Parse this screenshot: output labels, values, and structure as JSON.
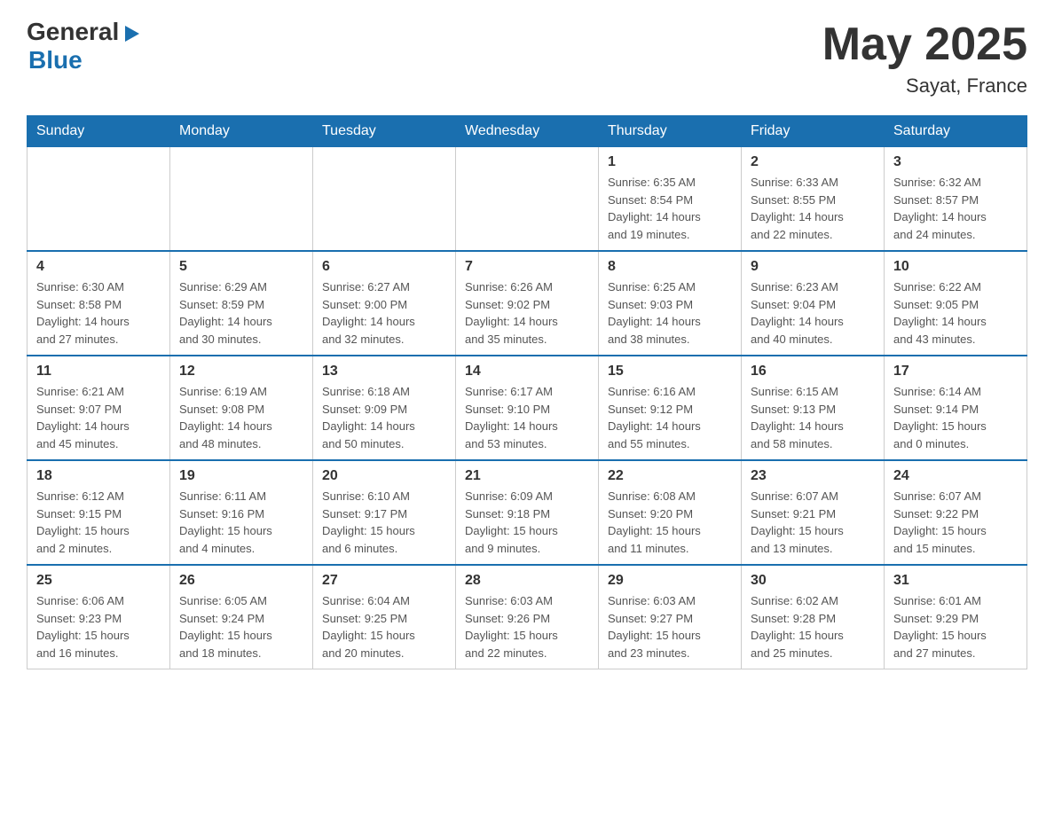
{
  "header": {
    "logo_general": "General",
    "logo_arrow": "▶",
    "logo_blue": "Blue",
    "month_year": "May 2025",
    "location": "Sayat, France"
  },
  "days_of_week": [
    "Sunday",
    "Monday",
    "Tuesday",
    "Wednesday",
    "Thursday",
    "Friday",
    "Saturday"
  ],
  "weeks": [
    [
      {
        "day": "",
        "info": ""
      },
      {
        "day": "",
        "info": ""
      },
      {
        "day": "",
        "info": ""
      },
      {
        "day": "",
        "info": ""
      },
      {
        "day": "1",
        "info": "Sunrise: 6:35 AM\nSunset: 8:54 PM\nDaylight: 14 hours\nand 19 minutes."
      },
      {
        "day": "2",
        "info": "Sunrise: 6:33 AM\nSunset: 8:55 PM\nDaylight: 14 hours\nand 22 minutes."
      },
      {
        "day": "3",
        "info": "Sunrise: 6:32 AM\nSunset: 8:57 PM\nDaylight: 14 hours\nand 24 minutes."
      }
    ],
    [
      {
        "day": "4",
        "info": "Sunrise: 6:30 AM\nSunset: 8:58 PM\nDaylight: 14 hours\nand 27 minutes."
      },
      {
        "day": "5",
        "info": "Sunrise: 6:29 AM\nSunset: 8:59 PM\nDaylight: 14 hours\nand 30 minutes."
      },
      {
        "day": "6",
        "info": "Sunrise: 6:27 AM\nSunset: 9:00 PM\nDaylight: 14 hours\nand 32 minutes."
      },
      {
        "day": "7",
        "info": "Sunrise: 6:26 AM\nSunset: 9:02 PM\nDaylight: 14 hours\nand 35 minutes."
      },
      {
        "day": "8",
        "info": "Sunrise: 6:25 AM\nSunset: 9:03 PM\nDaylight: 14 hours\nand 38 minutes."
      },
      {
        "day": "9",
        "info": "Sunrise: 6:23 AM\nSunset: 9:04 PM\nDaylight: 14 hours\nand 40 minutes."
      },
      {
        "day": "10",
        "info": "Sunrise: 6:22 AM\nSunset: 9:05 PM\nDaylight: 14 hours\nand 43 minutes."
      }
    ],
    [
      {
        "day": "11",
        "info": "Sunrise: 6:21 AM\nSunset: 9:07 PM\nDaylight: 14 hours\nand 45 minutes."
      },
      {
        "day": "12",
        "info": "Sunrise: 6:19 AM\nSunset: 9:08 PM\nDaylight: 14 hours\nand 48 minutes."
      },
      {
        "day": "13",
        "info": "Sunrise: 6:18 AM\nSunset: 9:09 PM\nDaylight: 14 hours\nand 50 minutes."
      },
      {
        "day": "14",
        "info": "Sunrise: 6:17 AM\nSunset: 9:10 PM\nDaylight: 14 hours\nand 53 minutes."
      },
      {
        "day": "15",
        "info": "Sunrise: 6:16 AM\nSunset: 9:12 PM\nDaylight: 14 hours\nand 55 minutes."
      },
      {
        "day": "16",
        "info": "Sunrise: 6:15 AM\nSunset: 9:13 PM\nDaylight: 14 hours\nand 58 minutes."
      },
      {
        "day": "17",
        "info": "Sunrise: 6:14 AM\nSunset: 9:14 PM\nDaylight: 15 hours\nand 0 minutes."
      }
    ],
    [
      {
        "day": "18",
        "info": "Sunrise: 6:12 AM\nSunset: 9:15 PM\nDaylight: 15 hours\nand 2 minutes."
      },
      {
        "day": "19",
        "info": "Sunrise: 6:11 AM\nSunset: 9:16 PM\nDaylight: 15 hours\nand 4 minutes."
      },
      {
        "day": "20",
        "info": "Sunrise: 6:10 AM\nSunset: 9:17 PM\nDaylight: 15 hours\nand 6 minutes."
      },
      {
        "day": "21",
        "info": "Sunrise: 6:09 AM\nSunset: 9:18 PM\nDaylight: 15 hours\nand 9 minutes."
      },
      {
        "day": "22",
        "info": "Sunrise: 6:08 AM\nSunset: 9:20 PM\nDaylight: 15 hours\nand 11 minutes."
      },
      {
        "day": "23",
        "info": "Sunrise: 6:07 AM\nSunset: 9:21 PM\nDaylight: 15 hours\nand 13 minutes."
      },
      {
        "day": "24",
        "info": "Sunrise: 6:07 AM\nSunset: 9:22 PM\nDaylight: 15 hours\nand 15 minutes."
      }
    ],
    [
      {
        "day": "25",
        "info": "Sunrise: 6:06 AM\nSunset: 9:23 PM\nDaylight: 15 hours\nand 16 minutes."
      },
      {
        "day": "26",
        "info": "Sunrise: 6:05 AM\nSunset: 9:24 PM\nDaylight: 15 hours\nand 18 minutes."
      },
      {
        "day": "27",
        "info": "Sunrise: 6:04 AM\nSunset: 9:25 PM\nDaylight: 15 hours\nand 20 minutes."
      },
      {
        "day": "28",
        "info": "Sunrise: 6:03 AM\nSunset: 9:26 PM\nDaylight: 15 hours\nand 22 minutes."
      },
      {
        "day": "29",
        "info": "Sunrise: 6:03 AM\nSunset: 9:27 PM\nDaylight: 15 hours\nand 23 minutes."
      },
      {
        "day": "30",
        "info": "Sunrise: 6:02 AM\nSunset: 9:28 PM\nDaylight: 15 hours\nand 25 minutes."
      },
      {
        "day": "31",
        "info": "Sunrise: 6:01 AM\nSunset: 9:29 PM\nDaylight: 15 hours\nand 27 minutes."
      }
    ]
  ]
}
